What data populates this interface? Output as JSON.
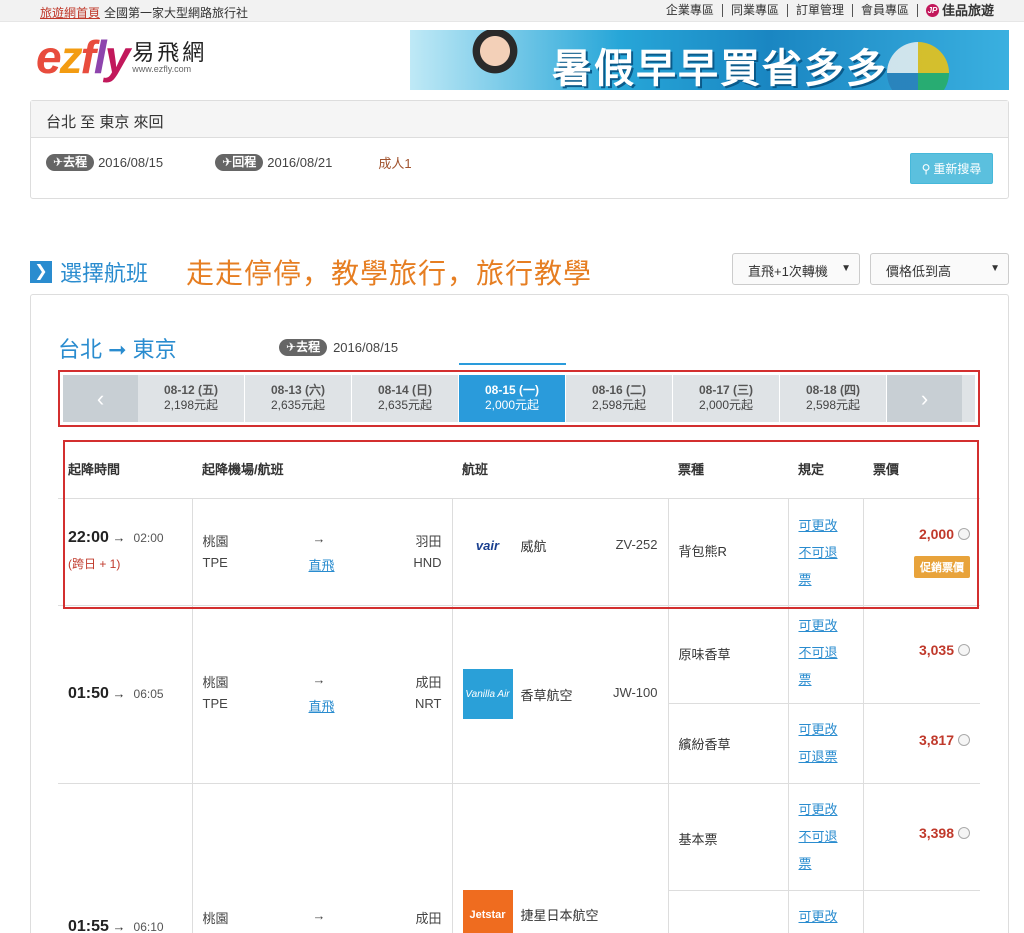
{
  "topbar": {
    "home": "旅遊網首頁",
    "slogan": "全國第一家大型網路旅行社",
    "links": [
      "企業專區",
      "同業專區",
      "訂單管理",
      "會員專區"
    ],
    "special": "佳品旅遊",
    "special_icon": "JP"
  },
  "logo": {
    "brand": "ezfly",
    "name": "易飛網",
    "url": "www.ezfly.com"
  },
  "banner": {
    "text": "暑假早早買省多多"
  },
  "summary": {
    "route": "台北 至 東京 來回",
    "outbound_label": "去程",
    "outbound_date": "2016/08/15",
    "return_label": "回程",
    "return_date": "2016/08/21",
    "pax": "成人1",
    "research": "重新搜尋"
  },
  "section": {
    "title": "選擇航班",
    "slogan": "走走停停，教學旅行，旅行教學",
    "filter": "直飛+1次轉機",
    "sort": "價格低到高"
  },
  "direction": {
    "text": "台北 ➞ 東京",
    "label": "去程",
    "date": "2016/08/15"
  },
  "dates": [
    {
      "date": "08-12 (五)",
      "price": "2,198元起"
    },
    {
      "date": "08-13 (六)",
      "price": "2,635元起"
    },
    {
      "date": "08-14 (日)",
      "price": "2,635元起"
    },
    {
      "date": "08-15 (一)",
      "price": "2,000元起",
      "active": true
    },
    {
      "date": "08-16 (二)",
      "price": "2,598元起"
    },
    {
      "date": "08-17 (三)",
      "price": "2,000元起"
    },
    {
      "date": "08-18 (四)",
      "price": "2,598元起"
    }
  ],
  "columns": [
    "起降時間",
    "起降機場/航班",
    "航班",
    "票種",
    "規定",
    "票價"
  ],
  "flights": [
    {
      "dep": "22:00",
      "arr": "02:00",
      "next_day": "(跨日 + 1)",
      "from": "桃園",
      "from_code": "TPE",
      "to": "羽田",
      "to_code": "HND",
      "direct": "直飛",
      "airline": "威航",
      "logo": "vair",
      "code": "ZV-252",
      "fares": [
        {
          "type": "背包熊R",
          "rule1": "可更改",
          "rule2": "不可退",
          "rule3": "票",
          "price": "2,000",
          "promo": "促銷票價"
        }
      ]
    },
    {
      "dep": "01:50",
      "arr": "06:05",
      "from": "桃園",
      "from_code": "TPE",
      "to": "成田",
      "to_code": "NRT",
      "direct": "直飛",
      "airline": "香草航空",
      "logo": "Vanilla Air",
      "code": "JW-100",
      "fares": [
        {
          "type": "原味香草",
          "rule1": "可更改",
          "rule2": "不可退",
          "rule3": "票",
          "price": "3,035"
        },
        {
          "type": "繽紛香草",
          "rule1": "可更改",
          "rule2": "可退票",
          "price": "3,817"
        }
      ]
    },
    {
      "dep": "01:55",
      "arr": "06:10",
      "from": "桃園",
      "to": "成田",
      "airline": "捷星日本航空",
      "logo": "Jetstar",
      "fares": [
        {
          "type": "基本票",
          "rule1": "可更改",
          "rule2": "不可退",
          "rule3": "票",
          "price": "3,398"
        },
        {
          "rule1": "可更改"
        }
      ]
    }
  ],
  "colors": {
    "accent": "#2a8ccf",
    "price": "#c0392b",
    "promo": "#e8a33b",
    "highlight": "#d32f2f"
  }
}
